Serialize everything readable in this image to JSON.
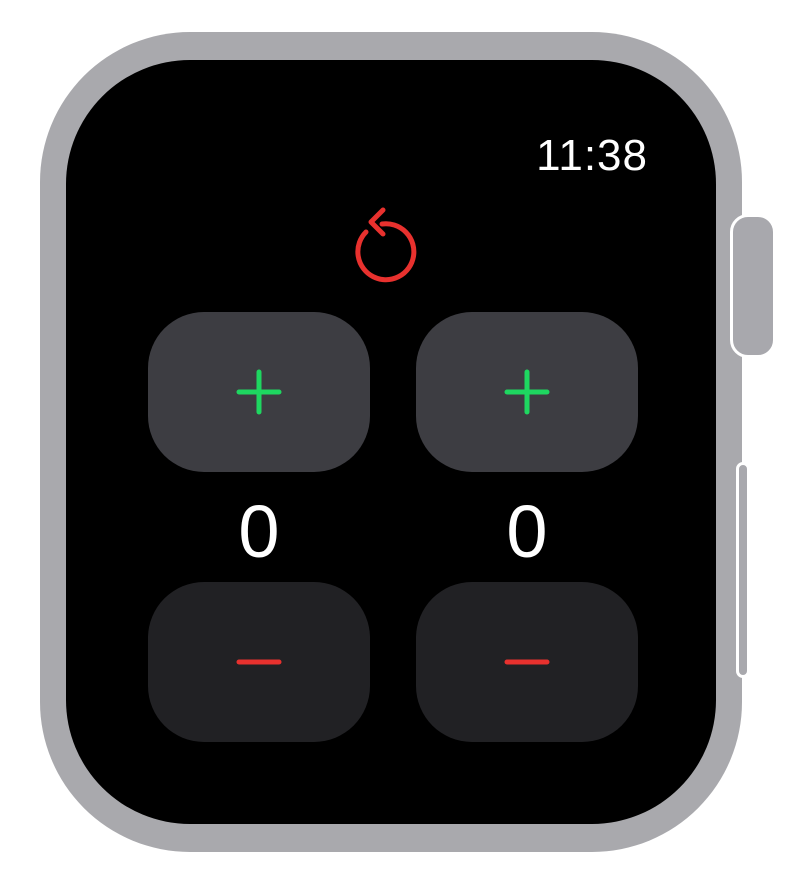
{
  "status_bar": {
    "time": "11:38"
  },
  "reset": {
    "icon": "reset-arrow-icon",
    "color": "#e8312e"
  },
  "counters": [
    {
      "value": "0",
      "increment_icon": "plus-icon",
      "decrement_icon": "minus-icon"
    },
    {
      "value": "0",
      "increment_icon": "plus-icon",
      "decrement_icon": "minus-icon"
    }
  ],
  "colors": {
    "screen_background": "#000000",
    "plus_button_background": "#3d3d42",
    "minus_button_background": "#212124",
    "plus_icon": "#1ed760",
    "minus_icon": "#e8312e",
    "case": "#a9a9ad"
  }
}
